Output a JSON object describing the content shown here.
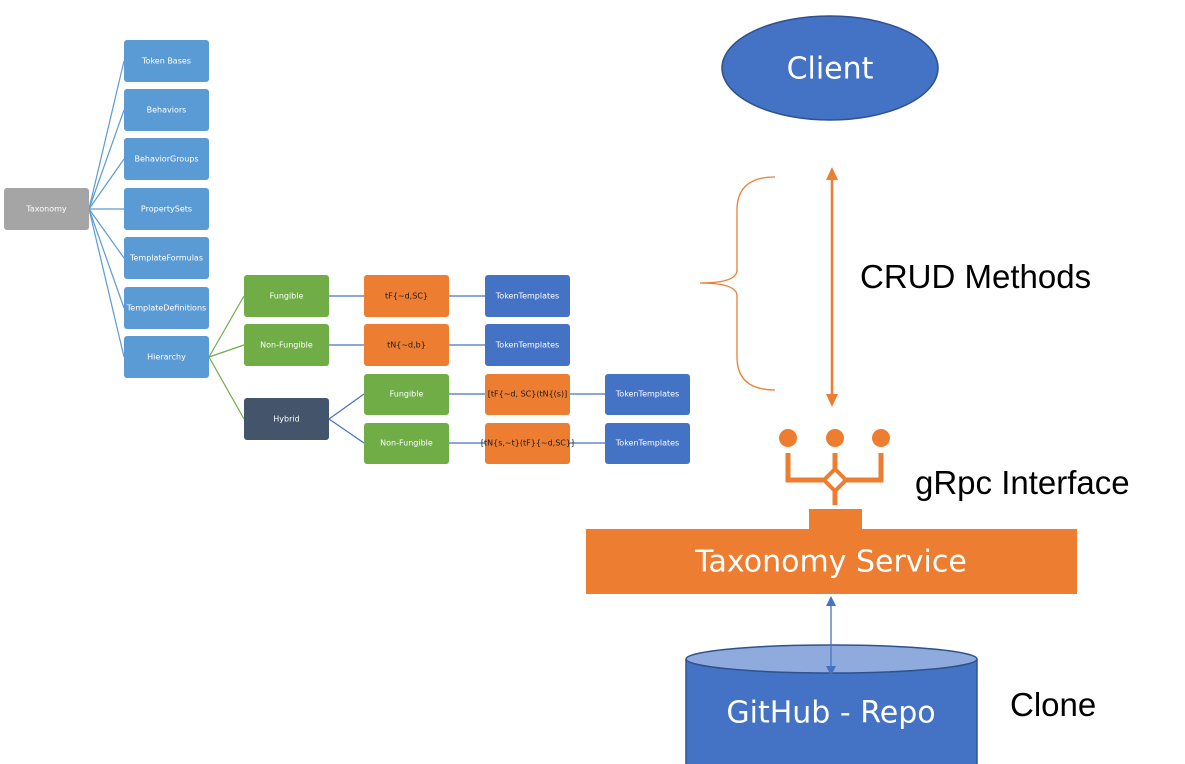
{
  "tree": {
    "root": "Taxonomy",
    "level1": [
      "Token Bases",
      "Behaviors",
      "BehaviorGroups",
      "PropertySets",
      "TemplateFormulas",
      "TemplateDefinitions",
      "Hierarchy"
    ],
    "hierarchy": {
      "fungible": {
        "label": "Fungible",
        "formula": "tF{~d,SC}",
        "templates": "TokenTemplates"
      },
      "non_fungible": {
        "label": "Non-Fungible",
        "formula": "tN{~d,b}",
        "templates": "TokenTemplates"
      },
      "hybrid": {
        "label": "Hybrid",
        "fungible": {
          "label": "Fungible",
          "formula": "[tF{~d, SC}(tN{(s)]",
          "templates": "TokenTemplates"
        },
        "non_fungible": {
          "label": "Non-Fungible",
          "formula": "[tN{s,~t}(tF}{~d,SC}]",
          "templates": "TokenTemplates"
        }
      }
    }
  },
  "architecture": {
    "client": "Client",
    "crud": "CRUD Methods",
    "grpc": "gRpc Interface",
    "service": "Taxonomy Service",
    "repo": "GitHub - Repo",
    "clone": "Clone"
  },
  "colors": {
    "root": "#a5a5a5",
    "level1": "#5b9bd5",
    "green": "#70ad47",
    "orange": "#ed7d31",
    "blue": "#4472c4",
    "dark": "#44546a",
    "repo_top": "#8faadc"
  }
}
